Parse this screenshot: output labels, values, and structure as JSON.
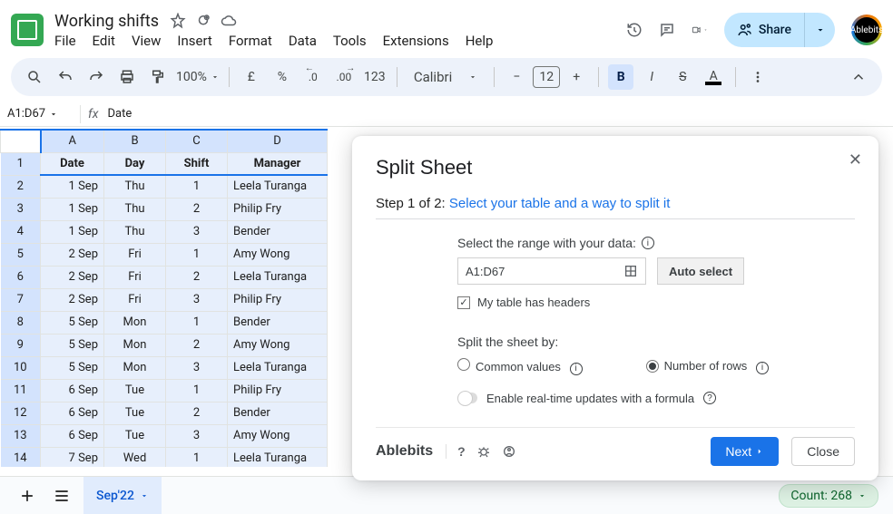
{
  "doc": {
    "name": "Working shifts"
  },
  "menu": [
    "File",
    "Edit",
    "View",
    "Insert",
    "Format",
    "Data",
    "Tools",
    "Extensions",
    "Help"
  ],
  "share": {
    "label": "Share"
  },
  "avatar": {
    "label": "Ablebits"
  },
  "toolbar": {
    "zoom": "100%",
    "currency": "£",
    "percent": "%",
    "dec_dec": ".0",
    "dec_inc": ".00",
    "numfmt": "123",
    "font": "Calibri",
    "fontsize": "12",
    "bold": "B",
    "italic": "I",
    "strike": "S",
    "textcolor": "A"
  },
  "namebox": "A1:D67",
  "fx": {
    "label": "fx",
    "value": "Date"
  },
  "columns": [
    "A",
    "B",
    "C",
    "D"
  ],
  "headers": [
    "Date",
    "Day",
    "Shift",
    "Manager"
  ],
  "rows": [
    {
      "n": "1"
    },
    {
      "n": "2",
      "date": "1 Sep",
      "day": "Thu",
      "shift": "1",
      "manager": "Leela Turanga"
    },
    {
      "n": "3",
      "date": "1 Sep",
      "day": "Thu",
      "shift": "2",
      "manager": "Philip Fry"
    },
    {
      "n": "4",
      "date": "1 Sep",
      "day": "Thu",
      "shift": "3",
      "manager": "Bender"
    },
    {
      "n": "5",
      "date": "2 Sep",
      "day": "Fri",
      "shift": "1",
      "manager": "Amy Wong"
    },
    {
      "n": "6",
      "date": "2 Sep",
      "day": "Fri",
      "shift": "2",
      "manager": "Leela Turanga"
    },
    {
      "n": "7",
      "date": "2 Sep",
      "day": "Fri",
      "shift": "3",
      "manager": "Philip Fry"
    },
    {
      "n": "8",
      "date": "5 Sep",
      "day": "Mon",
      "shift": "1",
      "manager": "Bender"
    },
    {
      "n": "9",
      "date": "5 Sep",
      "day": "Mon",
      "shift": "2",
      "manager": "Amy Wong"
    },
    {
      "n": "10",
      "date": "5 Sep",
      "day": "Mon",
      "shift": "3",
      "manager": "Leela Turanga"
    },
    {
      "n": "11",
      "date": "6 Sep",
      "day": "Tue",
      "shift": "1",
      "manager": "Philip Fry"
    },
    {
      "n": "12",
      "date": "6 Sep",
      "day": "Tue",
      "shift": "2",
      "manager": "Bender"
    },
    {
      "n": "13",
      "date": "6 Sep",
      "day": "Tue",
      "shift": "3",
      "manager": "Amy Wong"
    },
    {
      "n": "14",
      "date": "7 Sep",
      "day": "Wed",
      "shift": "1",
      "manager": "Leela Turanga"
    }
  ],
  "sheet_tab": "Sep'22",
  "status_count": "Count: 268",
  "panel": {
    "title": "Split Sheet",
    "step_prefix": "Step 1 of 2:",
    "step_link": "Select your table and a way to split it",
    "range_label": "Select the range with your data:",
    "range_value": "A1:D67",
    "autoselect": "Auto select",
    "headers_check": "My table has headers",
    "splitby_label": "Split the sheet by:",
    "opt_common": "Common values",
    "opt_rows": "Number of rows",
    "realtime": "Enable real-time updates with a formula",
    "brand": "Ablebits",
    "next": "Next",
    "close": "Close"
  }
}
